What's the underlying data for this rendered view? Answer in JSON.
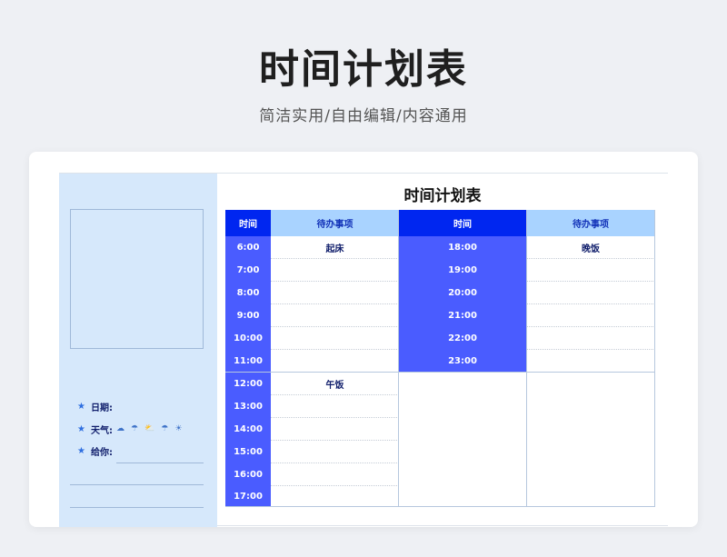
{
  "header": {
    "title": "时间计划表",
    "subtitle": "简洁实用/自由编辑/内容通用"
  },
  "sheet": {
    "title": "时间计划表"
  },
  "sidebar": {
    "date_label": "日期:",
    "weather_label": "天气:",
    "to_you_label": "给你:",
    "weather_icons": [
      "cloud-icon",
      "rain-icon",
      "cloud-sun-icon",
      "rain-icon",
      "sun-icon"
    ]
  },
  "colors": {
    "time_header": "#0026f0",
    "time_cell": "#4a5cff",
    "task_header": "#a9d3ff",
    "sidebar": "#d6e8fb"
  },
  "table": {
    "col_time": "时间",
    "col_tasks": "待办事项",
    "left": {
      "times": [
        "6:00",
        "7:00",
        "8:00",
        "9:00",
        "10:00",
        "11:00",
        "12:00",
        "13:00",
        "14:00",
        "15:00",
        "16:00",
        "17:00"
      ],
      "tasks": [
        "起床",
        "",
        "",
        "",
        "",
        "",
        "午饭",
        "",
        "",
        "",
        "",
        ""
      ]
    },
    "right": {
      "times": [
        "18:00",
        "19:00",
        "20:00",
        "21:00",
        "22:00",
        "23:00"
      ],
      "tasks": [
        "晚饭",
        "",
        "",
        "",
        "",
        ""
      ]
    }
  }
}
